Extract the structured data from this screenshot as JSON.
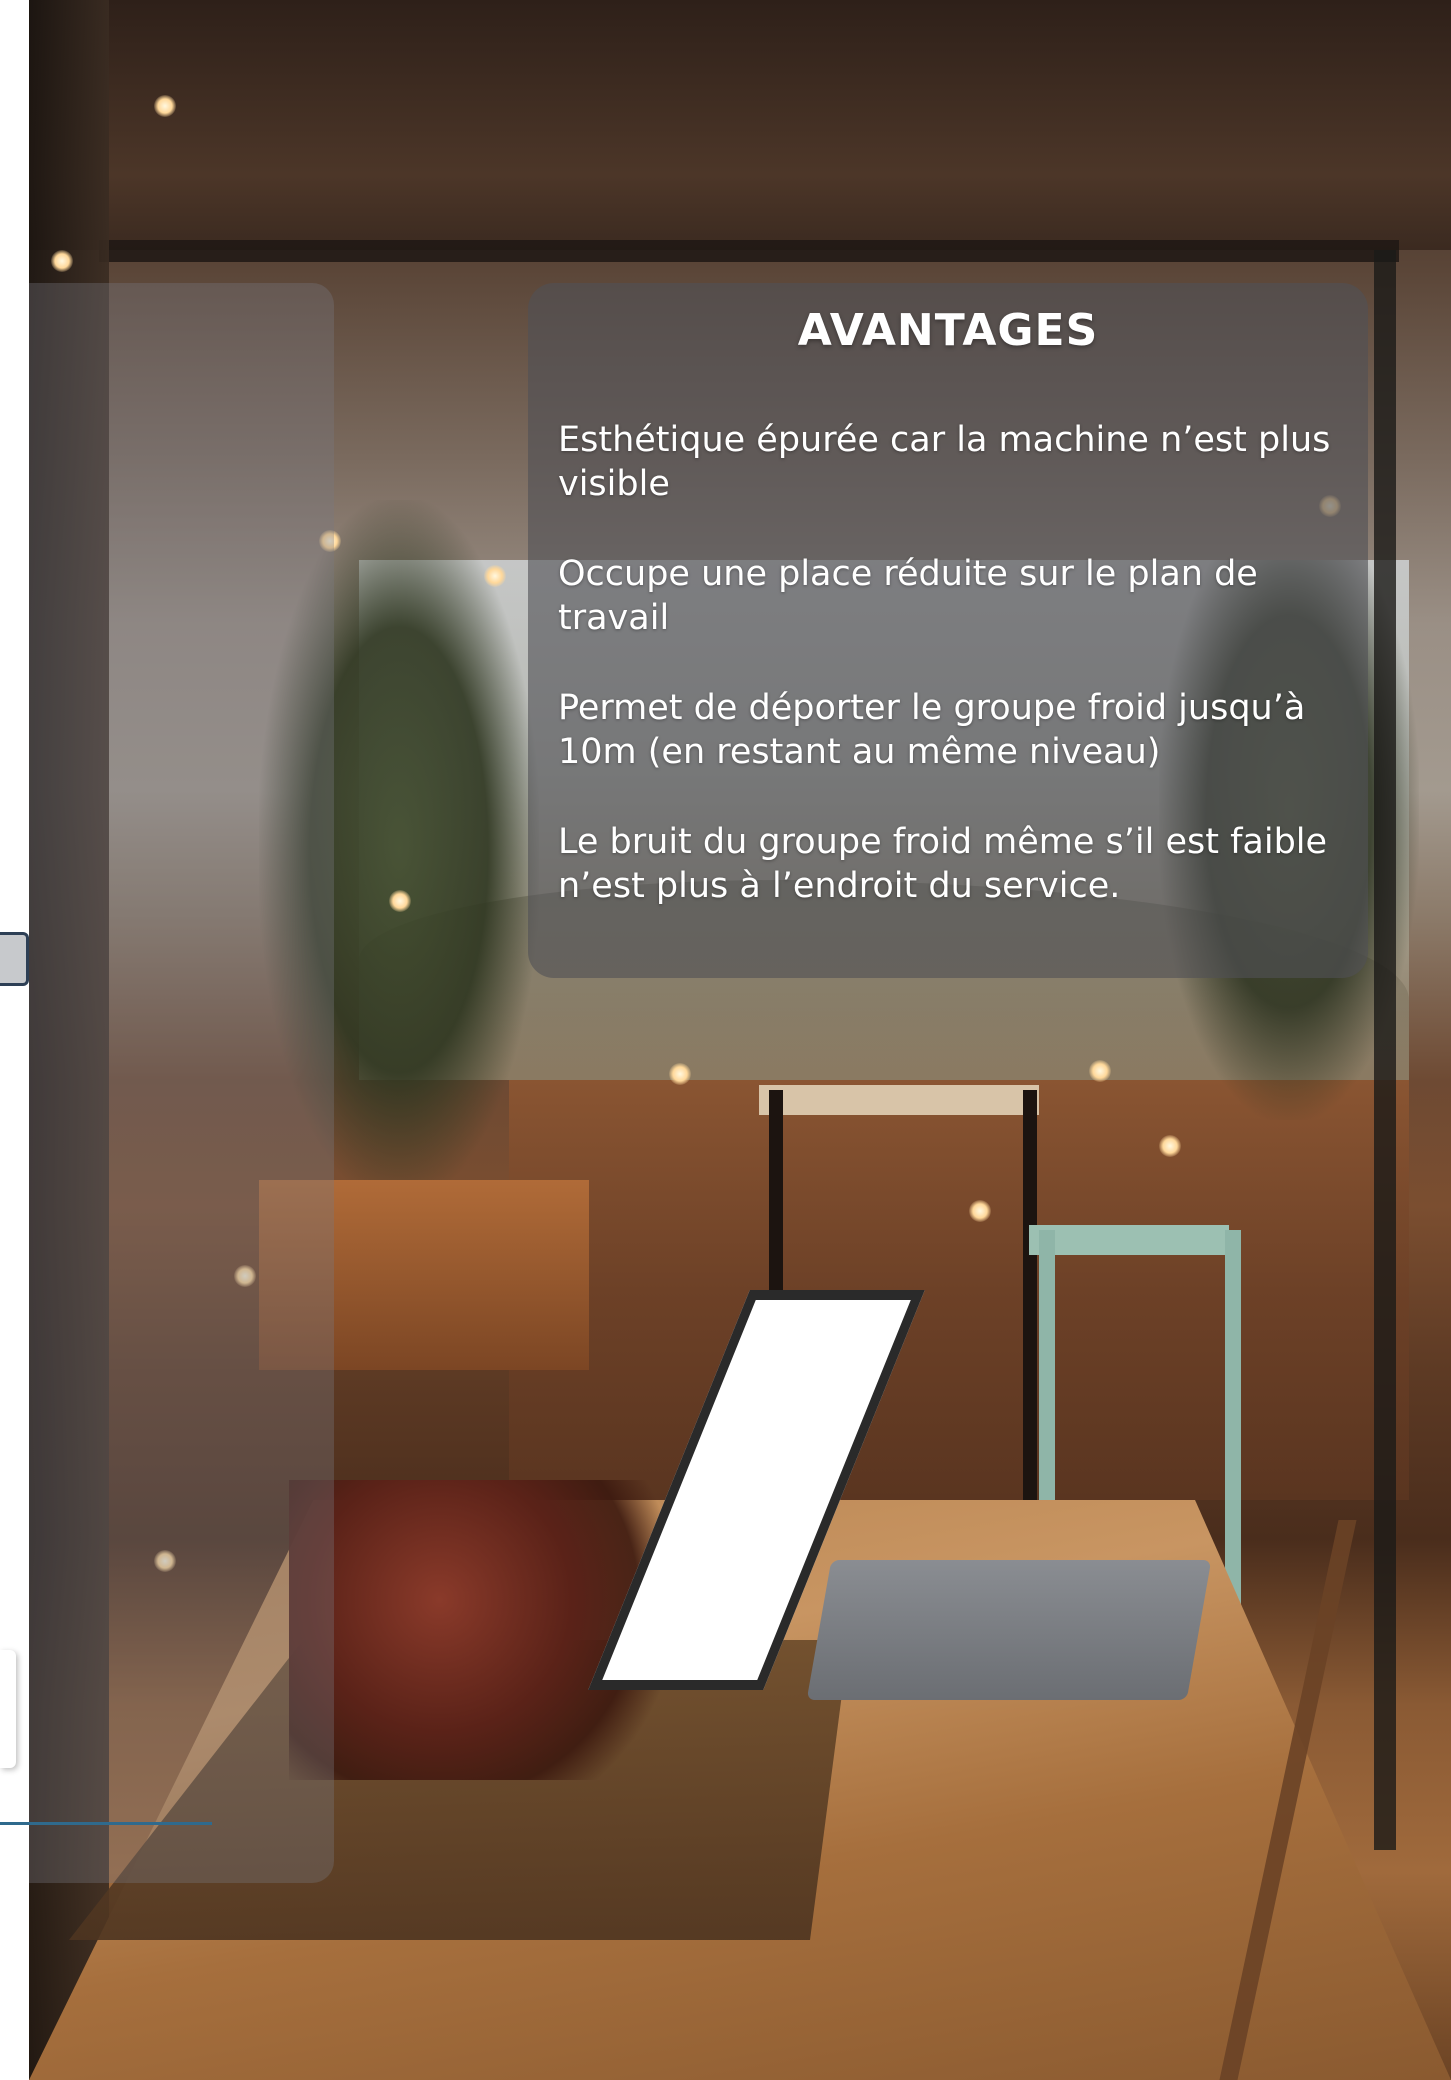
{
  "card": {
    "title": "AVANTAGES",
    "items": [
      "Esthétique épurée car la machine n’est plus visible",
      "Occupe une place réduite sur le plan de travail",
      "Permet de déporter le groupe froid jusqu’à 10m (en restant au même niveau)",
      "Le bruit du groupe froid même s’il est faible n’est plus à l’endroit du service."
    ]
  },
  "photo": {
    "subject": "laptop-on-wooden-table-terrace"
  },
  "colors": {
    "card_overlay": "#505056",
    "left_line": "#2f6a8d",
    "left_tab_border": "#2d3f55"
  }
}
